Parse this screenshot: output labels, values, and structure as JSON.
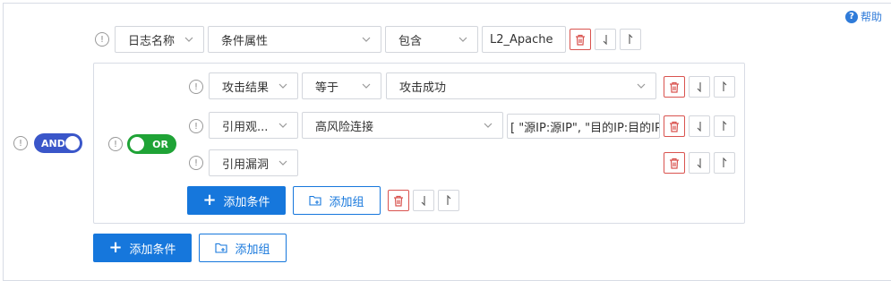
{
  "help": {
    "label": "帮助"
  },
  "root": {
    "toggle": "AND",
    "condition": {
      "field": "日志名称",
      "attribute": "条件属性",
      "operator": "包含",
      "value": "L2_Apache"
    },
    "add_condition": "添加条件",
    "add_group": "添加组"
  },
  "group": {
    "toggle": "OR",
    "conditions": [
      {
        "field": "攻击结果",
        "operator": "等于",
        "value": "攻击成功"
      },
      {
        "field": "引用观...",
        "operator": "高风险连接",
        "value": "[ \"源IP:源IP\", \"目的IP:目的IP\""
      },
      {
        "field": "引用漏洞"
      }
    ],
    "add_condition": "添加条件",
    "add_group": "添加组"
  },
  "icons": {
    "info": "info-circle-icon",
    "delete": "trash-icon",
    "move_down": "arrow-down-icon",
    "move_up": "arrow-up-icon",
    "folder_add": "folder-add-icon",
    "plus": "plus-icon",
    "chevron": "chevron-down-icon",
    "help": "question-circle-icon"
  },
  "colors": {
    "and_toggle": "#3a56c9",
    "or_toggle": "#1fa336",
    "primary": "#1677dc",
    "danger": "#d9534f"
  }
}
